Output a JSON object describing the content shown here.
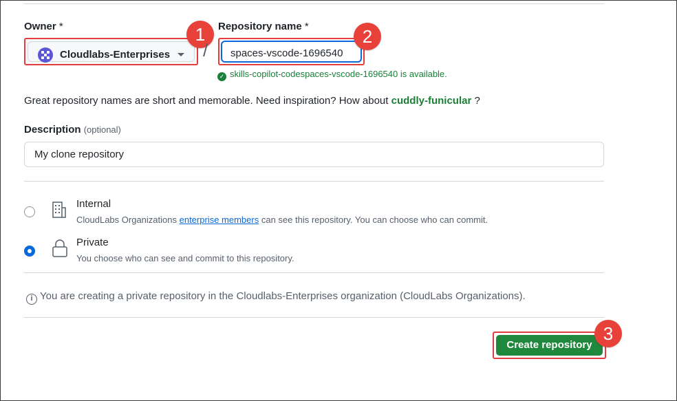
{
  "owner": {
    "label": "Owner",
    "required_mark": "*",
    "selected": "Cloudlabs-Enterprises"
  },
  "separator": "/",
  "repository": {
    "label": "Repository name",
    "required_mark": "*",
    "value": "spaces-vscode-1696540",
    "availability": "skills-copilot-codespaces-vscode-1696540 is available."
  },
  "hint": {
    "text": "Great repository names are short and memorable. Need inspiration? How about",
    "suggestion": "cuddly-funicular",
    "suffix": "?"
  },
  "description": {
    "label": "Description",
    "optional": "(optional)",
    "value": "My clone repository"
  },
  "visibility": {
    "internal": {
      "title": "Internal",
      "desc_prefix": "CloudLabs Organizations",
      "desc_link": "enterprise members",
      "desc_suffix": "can see this repository. You can choose who can commit.",
      "checked": false
    },
    "private": {
      "title": "Private",
      "desc": "You choose who can see and commit to this repository.",
      "checked": true
    }
  },
  "info": {
    "icon": "info-icon",
    "text": "You are creating a private repository in the Cloudlabs-Enterprises organization (CloudLabs Organizations)."
  },
  "create_button": "Create repository",
  "callouts": [
    "1",
    "2",
    "3"
  ],
  "colors": {
    "callout": "#e8413a",
    "primary_button": "#1f883d",
    "success": "#1a7f37",
    "link": "#0969da"
  }
}
